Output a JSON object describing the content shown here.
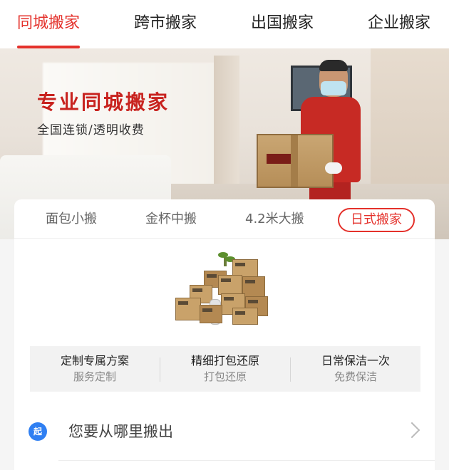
{
  "top_tabs": [
    {
      "label": "同城搬家",
      "active": true
    },
    {
      "label": "跨市搬家",
      "active": false
    },
    {
      "label": "出国搬家",
      "active": false
    },
    {
      "label": "企业搬家",
      "active": false
    }
  ],
  "banner": {
    "title": "专业同城搬家",
    "subtitle": "全国连锁/透明收费"
  },
  "vehicle_tabs": [
    {
      "label": "面包小搬",
      "selected": false
    },
    {
      "label": "金杯中搬",
      "selected": false
    },
    {
      "label": "4.2米大搬",
      "selected": false
    },
    {
      "label": "日式搬家",
      "selected": true
    }
  ],
  "features": [
    {
      "title": "定制专属方案",
      "sub": "服务定制"
    },
    {
      "title": "精细打包还原",
      "sub": "打包还原"
    },
    {
      "title": "日常保洁一次",
      "sub": "免费保洁"
    }
  ],
  "origin": {
    "badge": "起",
    "placeholder": "您要从哪里搬出",
    "icon": "chevron-right-icon"
  },
  "colors": {
    "accent": "#e4312b",
    "badge_blue": "#2f7ff2"
  }
}
